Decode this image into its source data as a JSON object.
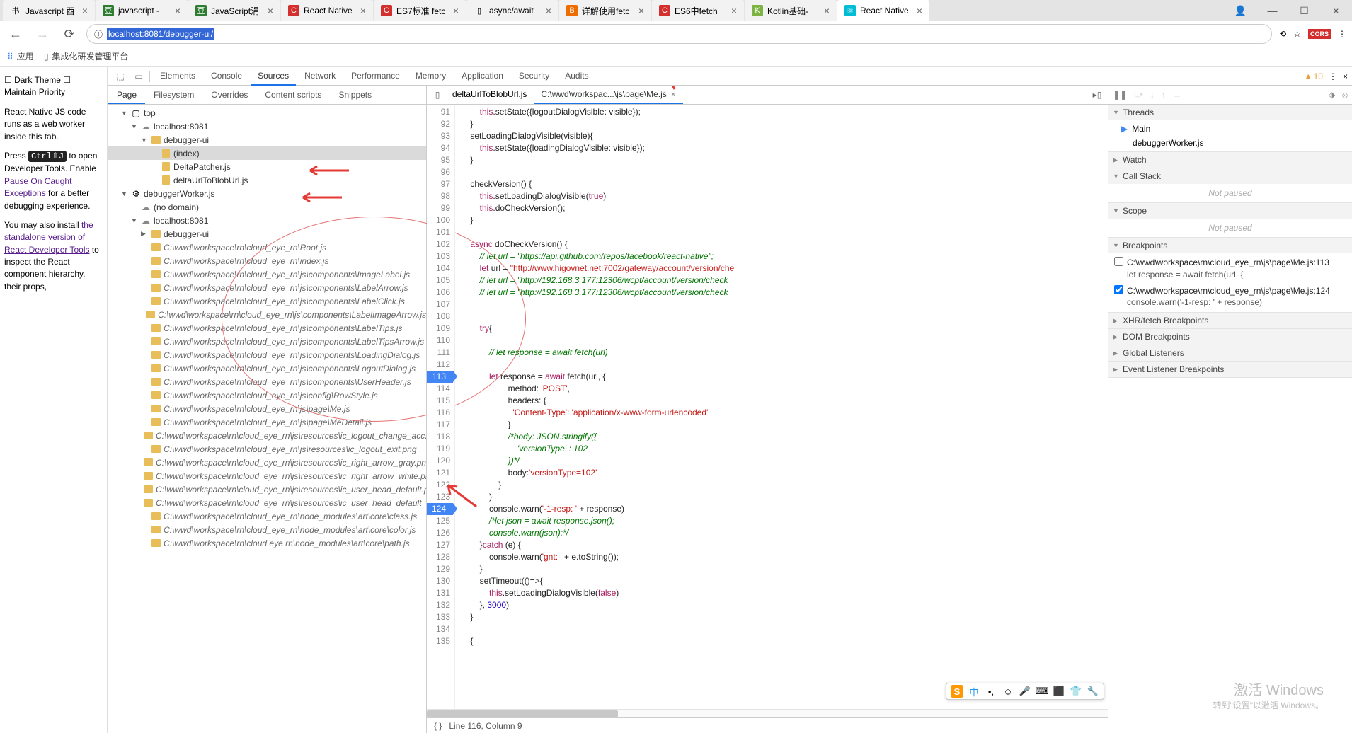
{
  "browser": {
    "tabs": [
      {
        "icon": "书",
        "title": "Javascript 酉"
      },
      {
        "icon": "豆",
        "title": "javascript - ",
        "iconbg": "#2e7d32"
      },
      {
        "icon": "豆",
        "title": "JavaScript涓",
        "iconbg": "#2e7d32"
      },
      {
        "icon": "C",
        "title": "React Native",
        "iconbg": "#d32f2f"
      },
      {
        "icon": "C",
        "title": "ES7标准 fetc",
        "iconbg": "#d32f2f"
      },
      {
        "icon": "▯",
        "title": "async/await"
      },
      {
        "icon": "B",
        "title": "详解使用fetc",
        "iconbg": "#ef6c00"
      },
      {
        "icon": "C",
        "title": "ES6中fetch",
        "iconbg": "#d32f2f"
      },
      {
        "icon": "K",
        "title": "Kotlin基础-",
        "iconbg": "#7cb342"
      },
      {
        "icon": "⚛",
        "title": "React Native",
        "iconbg": "#00bcd4",
        "active": true
      }
    ],
    "url_prefix": "ⓘ ",
    "url_sel": "localhost:8081/debugger-ui/",
    "bookmark_apps": "应用",
    "bookmark_item": "集成化研发管理平台"
  },
  "left": {
    "p1a": "☐ Dark Theme ☐ Maintain Priority",
    "p2": "React Native JS code runs as a web worker inside this tab.",
    "p3a": "Press ",
    "p3kbd": "Ctrl⇧J",
    "p3b": " to open Developer Tools. Enable ",
    "p3link": "Pause On Caught Exceptions",
    "p3c": " for a better debugging experience.",
    "p4a": "You may also install ",
    "p4link": "the standalone version of React Developer Tools",
    "p4b": " to inspect the React component hierarchy, their props,"
  },
  "devtools": {
    "tabs": [
      "Elements",
      "Console",
      "Sources",
      "Network",
      "Performance",
      "Memory",
      "Application",
      "Security",
      "Audits"
    ],
    "active": "Sources",
    "warn": "10"
  },
  "navigator": {
    "tabs": [
      "Page",
      "Filesystem",
      "Overrides",
      "Content scripts",
      "Snippets"
    ],
    "active": "Page",
    "tree": [
      {
        "d": 1,
        "arr": "▼",
        "ico": "▢",
        "lbl": "top"
      },
      {
        "d": 2,
        "arr": "▼",
        "ico": "cloud",
        "lbl": "localhost:8081"
      },
      {
        "d": 3,
        "arr": "▼",
        "ico": "fold",
        "lbl": "debugger-ui"
      },
      {
        "d": 4,
        "arr": "",
        "ico": "file",
        "lbl": "(index)",
        "sel": true
      },
      {
        "d": 4,
        "arr": "",
        "ico": "file",
        "lbl": "DeltaPatcher.js"
      },
      {
        "d": 4,
        "arr": "",
        "ico": "file",
        "lbl": "deltaUrlToBlobUrl.js"
      },
      {
        "d": 1,
        "arr": "▼",
        "ico": "gear",
        "lbl": "debuggerWorker.js",
        "red": true
      },
      {
        "d": 2,
        "arr": "",
        "ico": "cloud",
        "lbl": "(no domain)"
      },
      {
        "d": 2,
        "arr": "▼",
        "ico": "cloud",
        "lbl": "localhost:8081",
        "red": true
      },
      {
        "d": 3,
        "arr": "▶",
        "ico": "fold",
        "lbl": "debugger-ui"
      },
      {
        "d": 3,
        "arr": "",
        "ico": "fold",
        "lbl": "C:\\wwd\\workspace\\rn\\cloud_eye_rn\\Root.js",
        "it": true
      },
      {
        "d": 3,
        "arr": "",
        "ico": "fold",
        "lbl": "C:\\wwd\\workspace\\rn\\cloud_eye_rn\\index.js",
        "it": true
      },
      {
        "d": 3,
        "arr": "",
        "ico": "fold",
        "lbl": "C:\\wwd\\workspace\\rn\\cloud_eye_rn\\js\\components\\ImageLabel.js",
        "it": true
      },
      {
        "d": 3,
        "arr": "",
        "ico": "fold",
        "lbl": "C:\\wwd\\workspace\\rn\\cloud_eye_rn\\js\\components\\LabelArrow.js",
        "it": true
      },
      {
        "d": 3,
        "arr": "",
        "ico": "fold",
        "lbl": "C:\\wwd\\workspace\\rn\\cloud_eye_rn\\js\\components\\LabelClick.js",
        "it": true
      },
      {
        "d": 3,
        "arr": "",
        "ico": "fold",
        "lbl": "C:\\wwd\\workspace\\rn\\cloud_eye_rn\\js\\components\\LabelImageArrow.js",
        "it": true
      },
      {
        "d": 3,
        "arr": "",
        "ico": "fold",
        "lbl": "C:\\wwd\\workspace\\rn\\cloud_eye_rn\\js\\components\\LabelTips.js",
        "it": true
      },
      {
        "d": 3,
        "arr": "",
        "ico": "fold",
        "lbl": "C:\\wwd\\workspace\\rn\\cloud_eye_rn\\js\\components\\LabelTipsArrow.js",
        "it": true
      },
      {
        "d": 3,
        "arr": "",
        "ico": "fold",
        "lbl": "C:\\wwd\\workspace\\rn\\cloud_eye_rn\\js\\components\\LoadingDialog.js",
        "it": true
      },
      {
        "d": 3,
        "arr": "",
        "ico": "fold",
        "lbl": "C:\\wwd\\workspace\\rn\\cloud_eye_rn\\js\\components\\LogoutDialog.js",
        "it": true
      },
      {
        "d": 3,
        "arr": "",
        "ico": "fold",
        "lbl": "C:\\wwd\\workspace\\rn\\cloud_eye_rn\\js\\components\\UserHeader.js",
        "it": true
      },
      {
        "d": 3,
        "arr": "",
        "ico": "fold",
        "lbl": "C:\\wwd\\workspace\\rn\\cloud_eye_rn\\js\\config\\RowStyle.js",
        "it": true
      },
      {
        "d": 3,
        "arr": "",
        "ico": "fold",
        "lbl": "C:\\wwd\\workspace\\rn\\cloud_eye_rn\\js\\page\\Me.js",
        "it": true
      },
      {
        "d": 3,
        "arr": "",
        "ico": "fold",
        "lbl": "C:\\wwd\\workspace\\rn\\cloud_eye_rn\\js\\page\\MeDetail.js",
        "it": true
      },
      {
        "d": 3,
        "arr": "",
        "ico": "fold",
        "lbl": "C:\\wwd\\workspace\\rn\\cloud_eye_rn\\js\\resources\\ic_logout_change_acc.png",
        "it": true
      },
      {
        "d": 3,
        "arr": "",
        "ico": "fold",
        "lbl": "C:\\wwd\\workspace\\rn\\cloud_eye_rn\\js\\resources\\ic_logout_exit.png",
        "it": true
      },
      {
        "d": 3,
        "arr": "",
        "ico": "fold",
        "lbl": "C:\\wwd\\workspace\\rn\\cloud_eye_rn\\js\\resources\\ic_right_arrow_gray.png",
        "it": true
      },
      {
        "d": 3,
        "arr": "",
        "ico": "fold",
        "lbl": "C:\\wwd\\workspace\\rn\\cloud_eye_rn\\js\\resources\\ic_right_arrow_white.png",
        "it": true
      },
      {
        "d": 3,
        "arr": "",
        "ico": "fold",
        "lbl": "C:\\wwd\\workspace\\rn\\cloud_eye_rn\\js\\resources\\ic_user_head_default.png",
        "it": true
      },
      {
        "d": 3,
        "arr": "",
        "ico": "fold",
        "lbl": "C:\\wwd\\workspace\\rn\\cloud_eye_rn\\js\\resources\\ic_user_head_default_small",
        "it": true
      },
      {
        "d": 3,
        "arr": "",
        "ico": "fold",
        "lbl": "C:\\wwd\\workspace\\rn\\cloud_eye_rn\\node_modules\\art\\core\\class.js",
        "it": true
      },
      {
        "d": 3,
        "arr": "",
        "ico": "fold",
        "lbl": "C:\\wwd\\workspace\\rn\\cloud_eye_rn\\node_modules\\art\\core\\color.js",
        "it": true
      },
      {
        "d": 3,
        "arr": "",
        "ico": "fold",
        "lbl": "C:\\wwd\\workspace\\rn\\cloud eye rn\\node_modules\\art\\core\\path.js",
        "it": true
      }
    ]
  },
  "editor": {
    "tabs": [
      {
        "label": "deltaUrlToBlobUrl.js"
      },
      {
        "label": "C:\\wwd\\workspac...\\js\\page\\Me.js",
        "active": true
      }
    ],
    "firstLine": 91,
    "bpLines": [
      113,
      124
    ],
    "lines": [
      "        <span class='k'>this</span>.setState({logoutDialogVisible: visible});",
      "    }",
      "    setLoadingDialogVisible(visible){",
      "        <span class='k'>this</span>.setState({loadingDialogVisible: visible});",
      "    }",
      "",
      "    checkVersion() {",
      "        <span class='k'>this</span>.setLoadingDialogVisible(<span class='k'>true</span>)",
      "        <span class='k'>this</span>.doCheckVersion();",
      "    }",
      "",
      "    <span class='k'>async</span> doCheckVersion() {",
      "        <span class='c'>// let url = \"https://api.github.com/repos/facebook/react-native\";</span>",
      "        <span class='k'>let</span> url = <span class='s'>\"http://www.higovnet.net:7002/gateway/account/version/che</span>",
      "        <span class='c'>// let url = \"http://192.168.3.177:12306/wcpt/account/version/check</span>",
      "        <span class='c'>// let url = \"http://192.168.3.177:12306/wcpt/account/version/check</span>",
      "",
      "",
      "        <span class='k'>try</span>{",
      "",
      "            <span class='c'>// let response = await fetch(url)</span>",
      "",
      "            <span class='k'>let</span> response = <span class='k'>await</span> fetch(url, {",
      "                    method: <span class='s'>'POST'</span>,",
      "                    headers: {",
      "                      <span class='s'>'Content-Type'</span>: <span class='s'>'application/x-www-form-urlencoded'</span>",
      "                    },",
      "                    <span class='c'>/*body: JSON.stringify({</span>",
      "                        <span class='c'>'versionType' : 102</span>",
      "                    <span class='c'>})*/</span>",
      "                    body:<span class='s'>'versionType=102'</span>",
      "                }",
      "            )",
      "            console.warn(<span class='s'>'-1-resp: '</span> + response)",
      "            <span class='c'>/*let json = await response.json();</span>",
      "            <span class='c'>console.warn(json);*/</span>",
      "        }<span class='k'>catch</span> (e) {",
      "            console.warn(<span class='s'>'gnt: '</span> + e.toString());",
      "        }",
      "        setTimeout(()=>{",
      "            <span class='k'>this</span>.setLoadingDialogVisible(<span class='k'>false</span>)",
      "        }, <span class='n'>3000</span>)",
      "    }",
      "",
      "    {"
    ],
    "status": "Line 116, Column 9"
  },
  "rpanel": {
    "threads": {
      "title": "Threads",
      "items": [
        {
          "lbl": "Main",
          "active": true
        },
        {
          "lbl": "debuggerWorker.js"
        }
      ]
    },
    "watch": "Watch",
    "callstack": {
      "title": "Call Stack",
      "msg": "Not paused"
    },
    "scope": {
      "title": "Scope",
      "msg": "Not paused"
    },
    "breakpoints": {
      "title": "Breakpoints",
      "items": [
        {
          "checked": false,
          "loc": "C:\\wwd\\workspace\\rn\\cloud_eye_rn\\js\\page\\Me.js:113",
          "pre": "let response = await fetch(url, {"
        },
        {
          "checked": true,
          "loc": "C:\\wwd\\workspace\\rn\\cloud_eye_rn\\js\\page\\Me.js:124",
          "pre": "console.warn('-1-resp: ' + response)"
        }
      ]
    },
    "sections": [
      "XHR/fetch Breakpoints",
      "DOM Breakpoints",
      "Global Listeners",
      "Event Listener Breakpoints"
    ]
  },
  "ime": [
    "S",
    "中",
    "•,",
    "☺",
    "🎤",
    "⌨",
    "⬛",
    "👕",
    "🔧"
  ],
  "watermark": {
    "t": "激活 Windows",
    "s": "转到\"设置\"以激活 Windows。"
  }
}
